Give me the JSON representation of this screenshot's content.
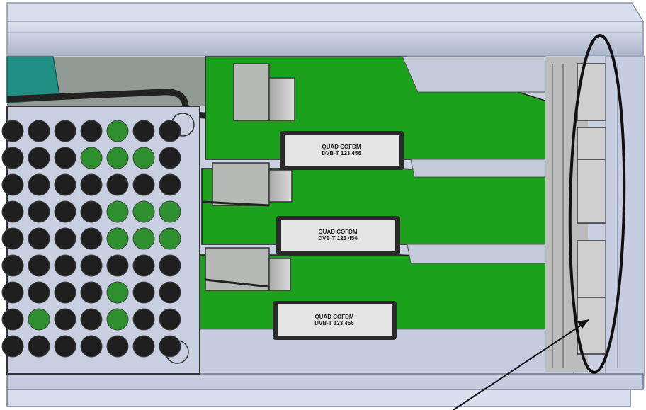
{
  "modules": [
    {
      "line1": "QUAD COFDM",
      "line2": "DVB-T 123 456"
    },
    {
      "line1": "QUAD COFDM",
      "line2": "DVB-T 123 456"
    },
    {
      "line1": "QUAD COFDM",
      "line2": "DVB-T 123 456"
    }
  ],
  "colors": {
    "chassis": "#c5cde0",
    "board": "#1aa01a",
    "outline": "#1a1a1a",
    "tab": "#e4e4e4"
  }
}
